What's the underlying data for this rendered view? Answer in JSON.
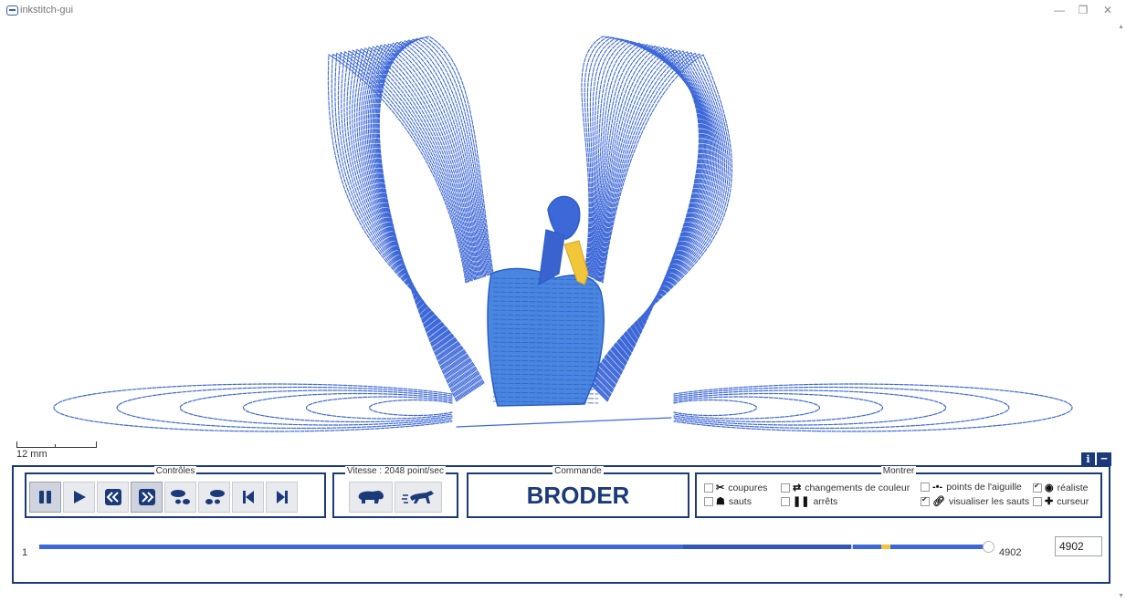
{
  "window": {
    "title": "inkstitch-gui",
    "minimize": "—",
    "restore": "❐",
    "close": "✕"
  },
  "scale": {
    "label": "12 mm"
  },
  "panel_buttons": {
    "info": "i",
    "minimize": "−"
  },
  "controls": {
    "legend": "Contrôles",
    "buttons": [
      {
        "name": "pause",
        "active": true
      },
      {
        "name": "play",
        "active": false
      },
      {
        "name": "rewind",
        "active": false
      },
      {
        "name": "fast-forward",
        "active": true
      },
      {
        "name": "step-backward",
        "active": false
      },
      {
        "name": "step-forward",
        "active": false
      },
      {
        "name": "skip-to-start",
        "active": false
      },
      {
        "name": "skip-to-end",
        "active": false
      }
    ]
  },
  "speed": {
    "legend": "Vitesse : 2048 point/sec"
  },
  "command": {
    "legend": "Commande",
    "value": "BRODER"
  },
  "show": {
    "legend": "Montrer",
    "options": {
      "coupures": {
        "label": "coupures",
        "checked": false
      },
      "sauts": {
        "label": "sauts",
        "checked": false
      },
      "changements": {
        "label": "changements de couleur",
        "checked": false
      },
      "arrets": {
        "label": "arrêts",
        "checked": false
      },
      "points": {
        "label": "points de l'aiguille",
        "checked": false
      },
      "visualiser": {
        "label": "visualiser les sauts",
        "checked": true
      },
      "realiste": {
        "label": "réaliste",
        "checked": true
      },
      "curseur": {
        "label": "curseur",
        "checked": false
      }
    }
  },
  "slider": {
    "min": "1",
    "max": "4902",
    "value": "4902"
  },
  "colors": {
    "accent": "#1b3a7a",
    "stitch_blue": "#3d68d8",
    "stitch_yellow": "#f2c63a"
  }
}
